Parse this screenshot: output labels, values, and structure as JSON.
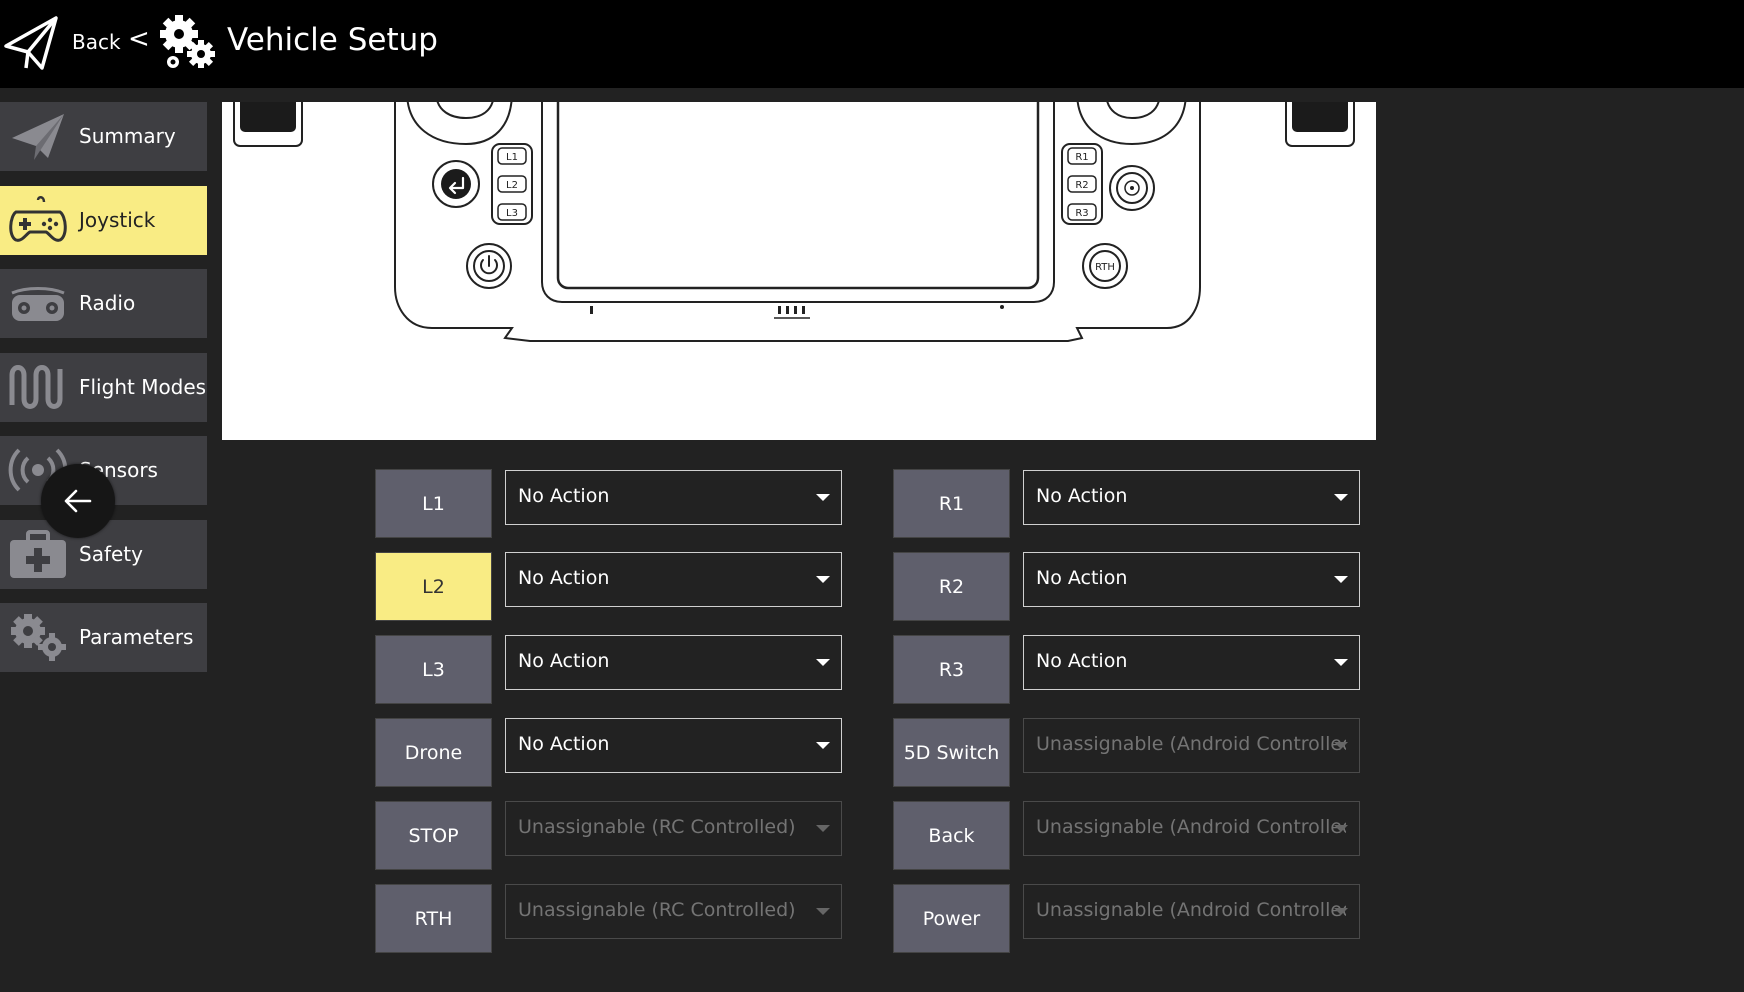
{
  "header": {
    "back_label": "Back",
    "separator": "<",
    "title": "Vehicle Setup"
  },
  "sidebar": {
    "items": [
      {
        "label": "Summary",
        "icon": "paper-plane-icon",
        "active": false
      },
      {
        "label": "Joystick",
        "icon": "gamepad-icon",
        "active": true
      },
      {
        "label": "Radio",
        "icon": "radio-icon",
        "active": false
      },
      {
        "label": "Flight Modes",
        "icon": "flight-modes-icon",
        "active": false
      },
      {
        "label": "Sensors",
        "icon": "sensors-icon",
        "active": false
      },
      {
        "label": "Safety",
        "icon": "safety-kit-icon",
        "active": false
      },
      {
        "label": "Parameters",
        "icon": "gears-icon",
        "active": false
      }
    ],
    "overlay_button_icon": "arrow-left-icon"
  },
  "controller": {
    "left_buttons": [
      "L1",
      "L2",
      "L3"
    ],
    "right_buttons": [
      "R1",
      "R2",
      "R3"
    ],
    "rth_label": "RTH"
  },
  "mappings": {
    "left": [
      {
        "button": "L1",
        "action": "No Action",
        "enabled": true
      },
      {
        "button": "L2",
        "action": "No Action",
        "enabled": true,
        "highlighted": true
      },
      {
        "button": "L3",
        "action": "No Action",
        "enabled": true
      },
      {
        "button": "Drone",
        "action": "No Action",
        "enabled": true
      },
      {
        "button": "STOP",
        "action": "Unassignable (RC Controlled)",
        "enabled": false
      },
      {
        "button": "RTH",
        "action": "Unassignable (RC Controlled)",
        "enabled": false
      }
    ],
    "right": [
      {
        "button": "R1",
        "action": "No Action",
        "enabled": true
      },
      {
        "button": "R2",
        "action": "No Action",
        "enabled": true
      },
      {
        "button": "R3",
        "action": "No Action",
        "enabled": true
      },
      {
        "button": "5D Switch",
        "action": "Unassignable (Android Controlled)",
        "enabled": false
      },
      {
        "button": "Back",
        "action": "Unassignable (Android Controlled)",
        "enabled": false
      },
      {
        "button": "Power",
        "action": "Unassignable (Android Controlled)",
        "enabled": false
      }
    ]
  },
  "colors": {
    "accent": "#f9ec84",
    "background": "#222222",
    "sidebar_item": "#3e3e42",
    "button": "#5f5f6c",
    "topbar": "#000000"
  }
}
